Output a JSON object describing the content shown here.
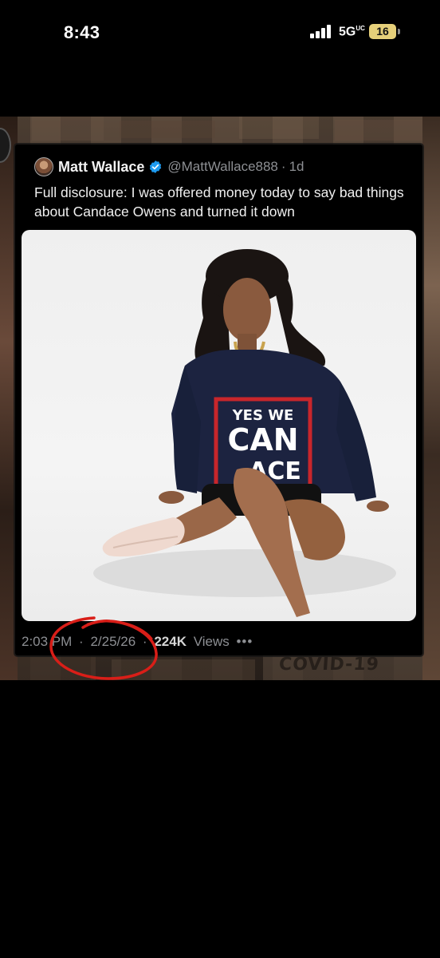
{
  "status_bar": {
    "time": "8:43",
    "network": "5G",
    "network_superscript": "UC",
    "battery": "16",
    "icons": [
      "signal-bars-icon",
      "battery-icon"
    ]
  },
  "background": {
    "wall_text": "COVID-19"
  },
  "tweet": {
    "author_name": "Matt Wallace",
    "handle": "@MattWallace888",
    "separator": "·",
    "time_ago": "1d",
    "text": "Full disclosure: I was offered money today to say bad things about Candace Owens and turned it down",
    "media": {
      "shirt_line1": "YES WE",
      "shirt_line2": "CAN",
      "shirt_line3": "ACE"
    },
    "footer": {
      "time": "2:03 PM",
      "date": "2/25/26",
      "views": "224K",
      "views_label": "Views",
      "more": "•••"
    }
  },
  "colors": {
    "verified_badge": "#1d9bf0",
    "annotation_circle": "#d91e18",
    "battery": "#e6d07a"
  }
}
